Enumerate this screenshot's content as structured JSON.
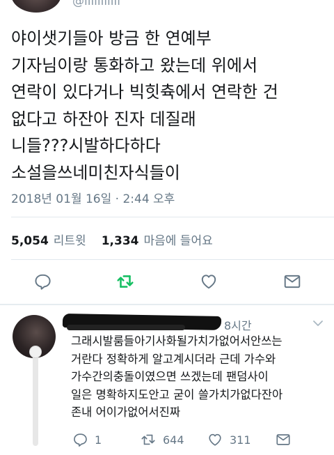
{
  "tweet": {
    "handle": "@lllllllllll",
    "text": "야이샛기들아 방금 한 연예부\n기자님이랑 통화하고 왔는데 위에서\n연락이 있다거나 빅힛츅에서 연락한 건\n없다고 하잔아 진자 데질래\n니들???시발하다하다\n소설을쓰네미친자식들이",
    "timestamp": "2018년 01월 16일 · 2:44 오후",
    "retweet_count": "5,054",
    "retweet_label": "리트윗",
    "like_count": "1,334",
    "like_label": "마음에 들어요"
  },
  "colors": {
    "retweet_active": "#17bf63",
    "icon_gray": "#657786",
    "text": "#14171a"
  },
  "reply": {
    "time": "8시간",
    "text": "그래시발룸들아기사화될가치가없어서안쓰는\n거란다 정확하게 알고계시더라 근데 가수와\n가수간의충돌이였으면 쓰겠는데 팬덤사이\n일은 명확하지도안고 굳이 쓸가치가없다잔아\n존내 어이가없어서진짜",
    "reply_count": "1",
    "retweet_count": "644",
    "like_count": "311"
  },
  "icons": [
    "reply-icon",
    "retweet-icon",
    "heart-icon",
    "message-icon",
    "chevron-down-icon"
  ]
}
